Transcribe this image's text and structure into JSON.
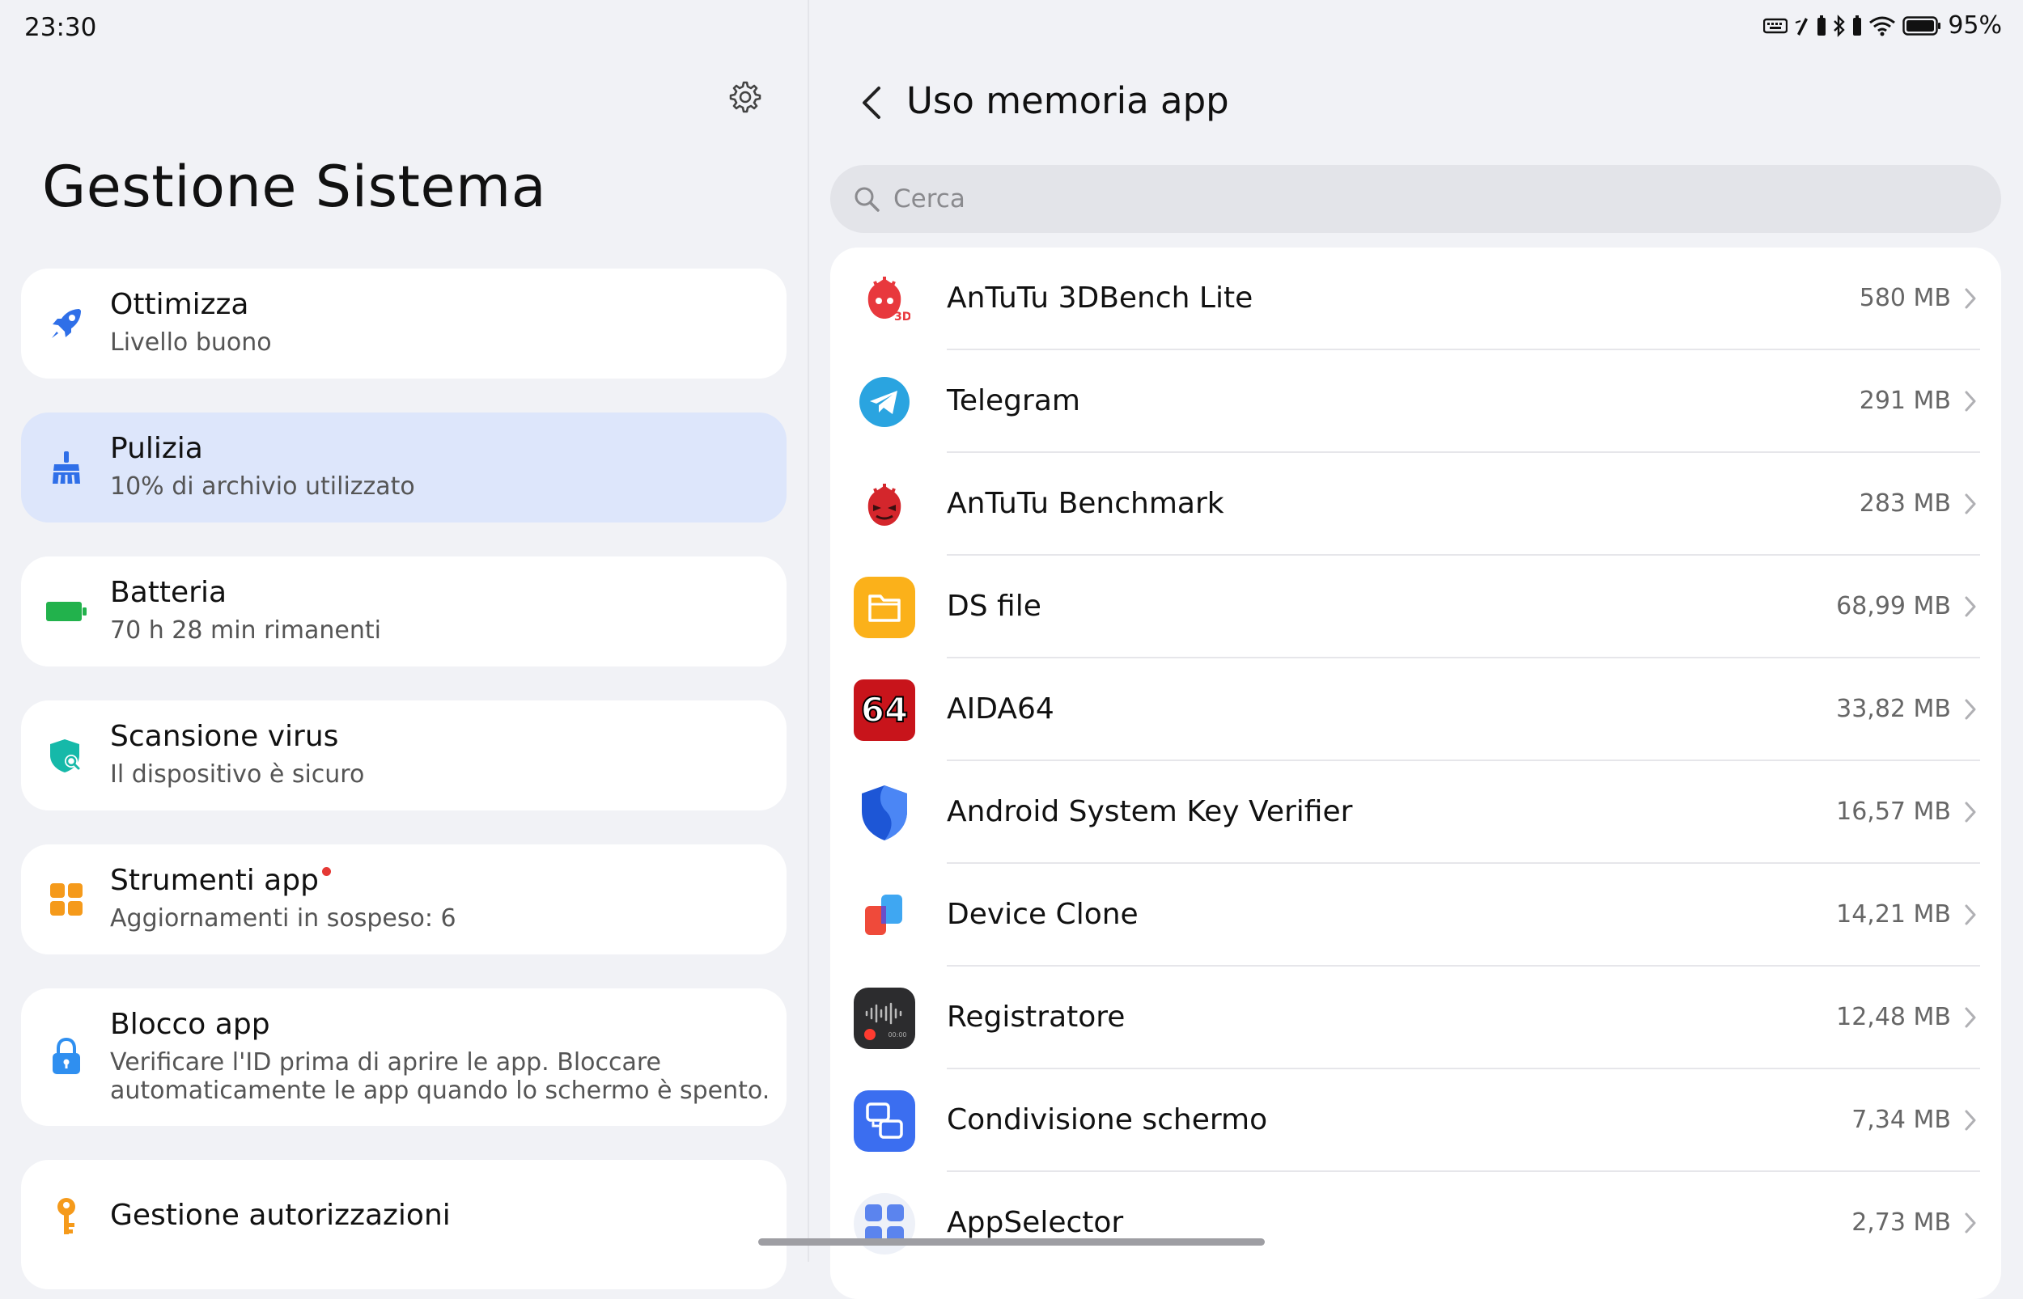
{
  "status_bar": {
    "time": "23:30",
    "battery_pct": "95%"
  },
  "left": {
    "title": "Gestione Sistema",
    "items": [
      {
        "label": "Ottimizza",
        "sub": "Livello buono",
        "icon": "rocket-icon",
        "color": "#2f6fe8"
      },
      {
        "label": "Pulizia",
        "sub": "10% di archivio utilizzato",
        "icon": "broom-icon",
        "color": "#2f6fe8",
        "active": true
      },
      {
        "label": "Batteria",
        "sub": "70 h 28 min rimanenti",
        "icon": "battery-icon",
        "color": "#22b24c"
      },
      {
        "label": "Scansione virus",
        "sub": "Il dispositivo è sicuro",
        "icon": "shield-icon",
        "color": "#16b9a9"
      },
      {
        "label": "Strumenti app",
        "sub": "Aggiornamenti in sospeso: 6",
        "icon": "grid-icon",
        "color": "#f59a1b",
        "badge": true
      },
      {
        "label": "Blocco app",
        "sub": "Verificare l'ID prima di aprire le app. Bloccare automaticamente le app quando lo schermo è spento.",
        "icon": "lock-icon",
        "color": "#2f8ff0"
      },
      {
        "label": "Gestione autorizzazioni",
        "sub": "",
        "icon": "key-icon",
        "color": "#f59a1b"
      }
    ]
  },
  "right": {
    "title": "Uso memoria app",
    "search_placeholder": "Cerca",
    "apps": [
      {
        "name": "AnTuTu 3DBench Lite",
        "size": "580 MB",
        "icon": "antutu-3dbench-icon"
      },
      {
        "name": "Telegram",
        "size": "291 MB",
        "icon": "telegram-icon"
      },
      {
        "name": "AnTuTu Benchmark",
        "size": "283 MB",
        "icon": "antutu-icon"
      },
      {
        "name": "DS file",
        "size": "68,99 MB",
        "icon": "ds-file-icon"
      },
      {
        "name": "AIDA64",
        "size": "33,82 MB",
        "icon": "aida64-icon"
      },
      {
        "name": "Android System Key Verifier",
        "size": "16,57 MB",
        "icon": "key-verifier-icon"
      },
      {
        "name": "Device Clone",
        "size": "14,21 MB",
        "icon": "device-clone-icon"
      },
      {
        "name": "Registratore",
        "size": "12,48 MB",
        "icon": "recorder-icon"
      },
      {
        "name": "Condivisione schermo",
        "size": "7,34 MB",
        "icon": "screen-share-icon"
      },
      {
        "name": "AppSelector",
        "size": "2,73 MB",
        "icon": "app-selector-icon"
      }
    ]
  }
}
